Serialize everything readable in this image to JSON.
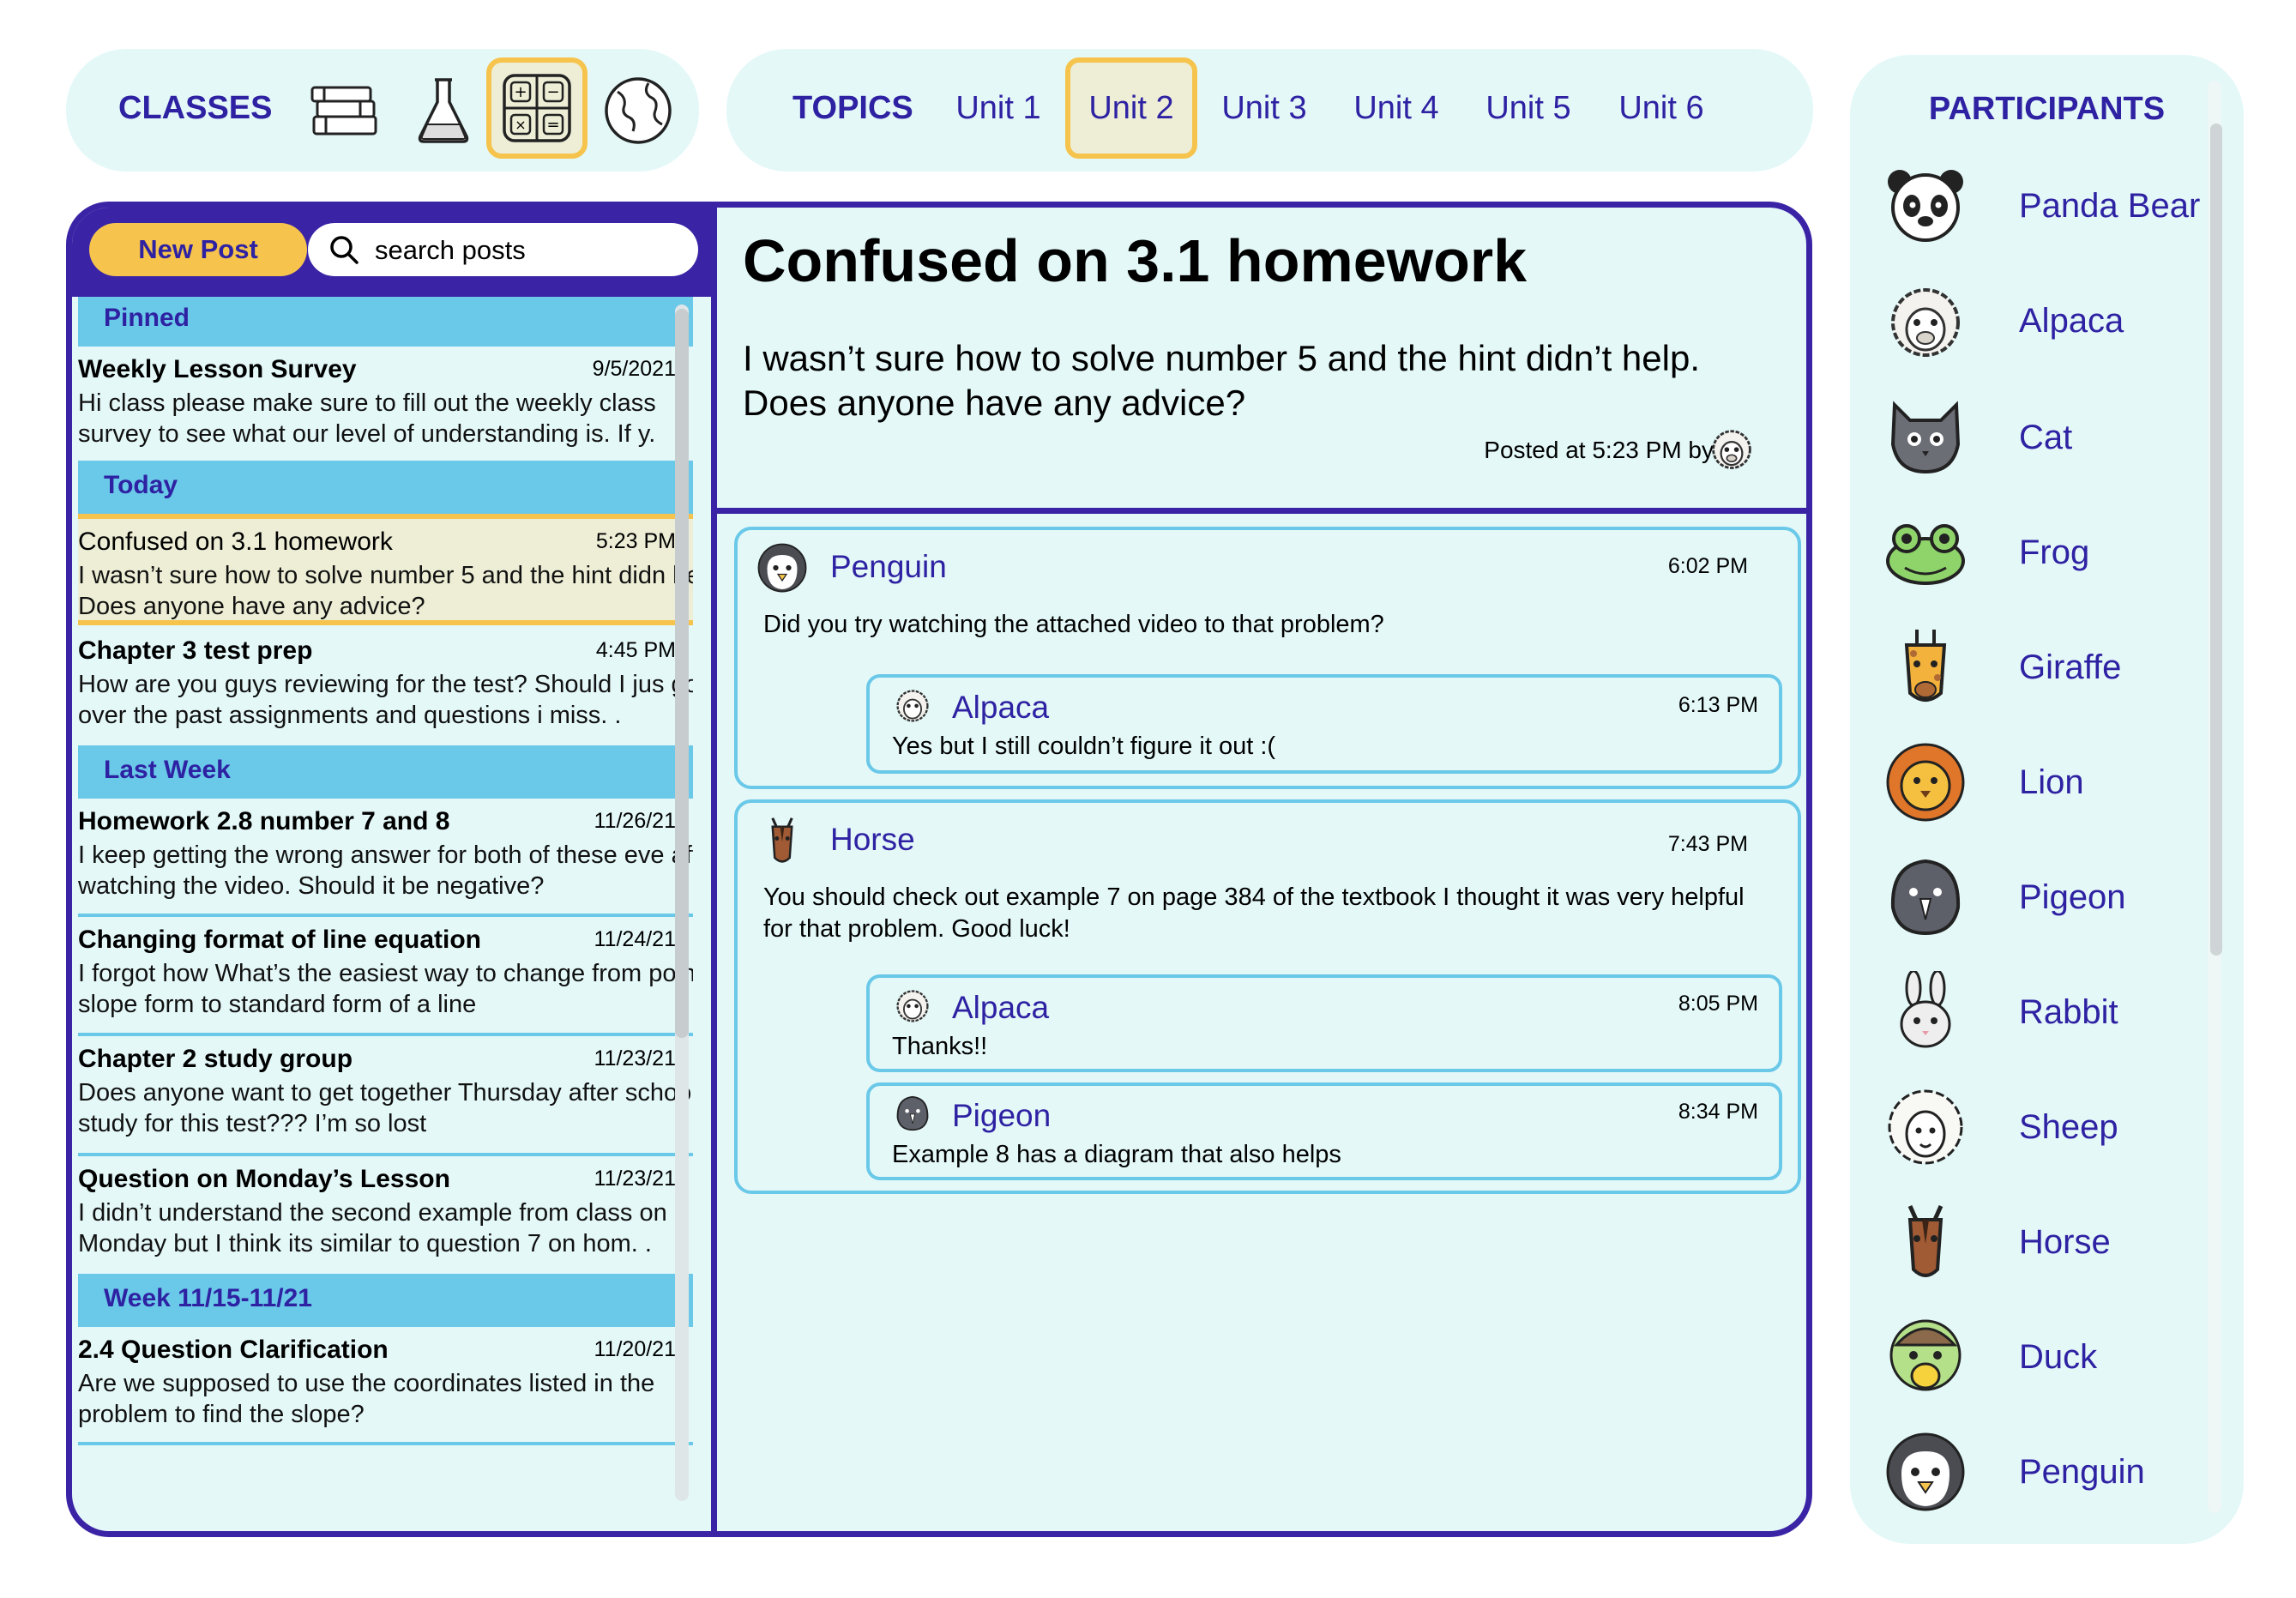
{
  "classes": {
    "label": "CLASSES",
    "icons": [
      "books-icon",
      "flask-icon",
      "calculator-icon",
      "globe-icon"
    ],
    "active_icon": "calculator-icon"
  },
  "topics": {
    "label": "TOPICS",
    "units": [
      "Unit 1",
      "Unit 2",
      "Unit 3",
      "Unit 4",
      "Unit 5",
      "Unit 6"
    ],
    "active_unit": "Unit 2"
  },
  "participants": {
    "label": "PARTICIPANTS",
    "list": [
      {
        "name": "Panda Bear",
        "icon": "panda-icon"
      },
      {
        "name": "Alpaca",
        "icon": "alpaca-icon"
      },
      {
        "name": "Cat",
        "icon": "cat-icon"
      },
      {
        "name": "Frog",
        "icon": "frog-icon"
      },
      {
        "name": "Giraffe",
        "icon": "giraffe-icon"
      },
      {
        "name": "Lion",
        "icon": "lion-icon"
      },
      {
        "name": "Pigeon",
        "icon": "pigeon-icon"
      },
      {
        "name": "Rabbit",
        "icon": "rabbit-icon"
      },
      {
        "name": "Sheep",
        "icon": "sheep-icon"
      },
      {
        "name": "Horse",
        "icon": "horse-icon"
      },
      {
        "name": "Duck",
        "icon": "duck-icon"
      },
      {
        "name": "Penguin",
        "icon": "penguin-icon"
      }
    ]
  },
  "sidebar": {
    "new_post_label": "New Post",
    "search_placeholder": "search posts",
    "sections": [
      {
        "label": "Pinned"
      },
      {
        "label": "Today"
      },
      {
        "label": "Last Week"
      },
      {
        "label": "Week 11/15-11/21"
      }
    ],
    "posts": [
      {
        "title": "Weekly Lesson Survey",
        "date": "9/5/2021",
        "excerpt": "Hi class please make sure to fill out the weekly class survey to see what our level of understanding is. If y."
      },
      {
        "title": "Confused on 3.1 homework",
        "date": "5:23 PM",
        "excerpt": "I wasn’t sure how to solve number 5 and the hint didn help. Does anyone have any advice?"
      },
      {
        "title": "Chapter 3 test prep",
        "date": "4:45 PM",
        "excerpt": "How are you guys reviewing for the test? Should I jus go over the past assignments and questions i miss. ."
      },
      {
        "title": "Homework 2.8 number 7 and 8",
        "date": "11/26/21",
        "excerpt": "I keep getting the wrong answer for both of these eve after watching the video. Should it be negative?"
      },
      {
        "title": "Changing format of line equation",
        "date": "11/24/21",
        "excerpt": "I forgot how What’s the easiest way to change from point slope form to standard form of a line"
      },
      {
        "title": "Chapter 2 study group",
        "date": "11/23/21",
        "excerpt": "Does anyone want to get together Thursday after school to study for this test??? I’m so lost"
      },
      {
        "title": "Question on Monday’s Lesson",
        "date": "11/23/21",
        "excerpt": "I didn’t understand the second example from class on Monday but I think its similar to question 7 on hom. ."
      },
      {
        "title": "2.4 Question Clarification",
        "date": "11/20/21",
        "excerpt": "Are we supposed to use the coordinates listed in the problem to find the slope?"
      }
    ]
  },
  "post": {
    "title": "Confused on 3.1 homework",
    "body": "I wasn’t sure how to solve number 5 and the hint didn’t help. Does anyone have any advice?",
    "meta": "Posted at 5:23 PM by",
    "author_icon": "alpaca-icon"
  },
  "comments": [
    {
      "name": "Penguin",
      "time": "6:02 PM",
      "icon": "penguin-icon",
      "text": "Did you try watching the attached video to that problem?",
      "replies": [
        {
          "name": "Alpaca",
          "time": "6:13 PM",
          "icon": "alpaca-icon",
          "text": "Yes but I still couldn’t figure it out :("
        }
      ]
    },
    {
      "name": "Horse",
      "time": "7:43 PM",
      "icon": "horse-icon",
      "text": "You should check out example 7 on page 384 of the textbook I thought it was very helpful for that problem. Good luck!",
      "replies": [
        {
          "name": "Alpaca",
          "time": "8:05 PM",
          "icon": "alpaca-icon",
          "text": "Thanks!!"
        },
        {
          "name": "Pigeon",
          "time": "8:34 PM",
          "icon": "pigeon-icon",
          "text": "Example 8 has a diagram that also helps"
        }
      ]
    }
  ],
  "colors": {
    "accent": "#3a24a5",
    "label_text": "#2e22a3",
    "panel_bg": "#e4f8f8",
    "section_bg": "#6ac8e8",
    "highlight": "#f6c44c",
    "selected_bg": "#eeeed6"
  }
}
